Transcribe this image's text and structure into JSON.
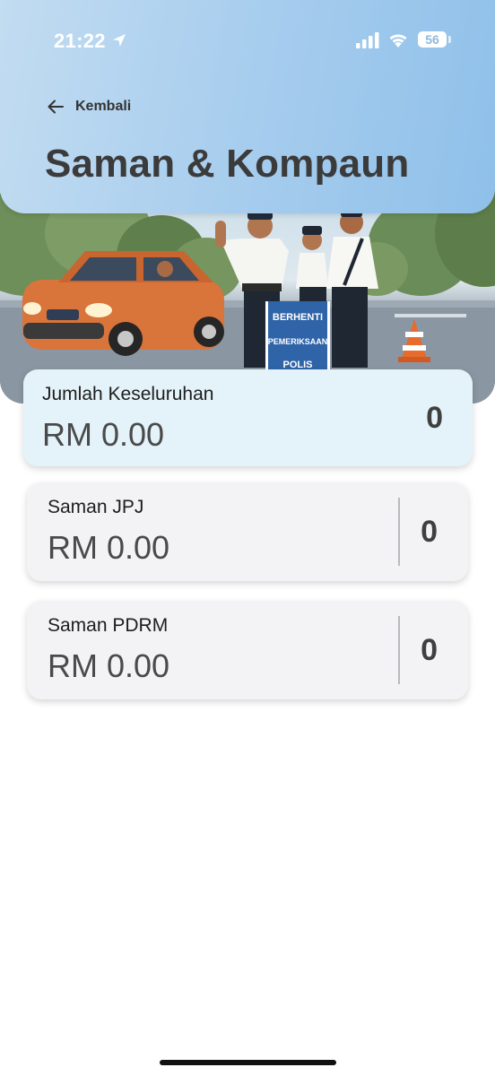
{
  "status_bar": {
    "time": "21:22",
    "battery_level": "56",
    "icons": [
      "location-arrow-icon",
      "cellular-signal-icon",
      "wifi-icon",
      "battery-icon"
    ]
  },
  "header": {
    "back_label": "Kembali",
    "title": "Saman & Kompaun",
    "back_icon": "arrow-left-icon"
  },
  "hero_image": {
    "sign_lines": [
      "BERHENTI",
      "PEMERIKSAAN",
      "POLIS"
    ]
  },
  "summary": {
    "total": {
      "label": "Jumlah Keseluruhan",
      "amount": "RM 0.00",
      "count": "0"
    },
    "jpj": {
      "label": "Saman JPJ",
      "amount": "RM 0.00",
      "count": "0"
    },
    "pdrm": {
      "label": "Saman PDRM",
      "amount": "RM 0.00",
      "count": "0"
    }
  },
  "colors": {
    "header_gradient_start": "#c2dcf1",
    "header_gradient_end": "#8fc0e9",
    "total_card_bg": "#e4f3fa",
    "card_bg": "#f3f3f5",
    "car_orange": "#d9743a"
  }
}
